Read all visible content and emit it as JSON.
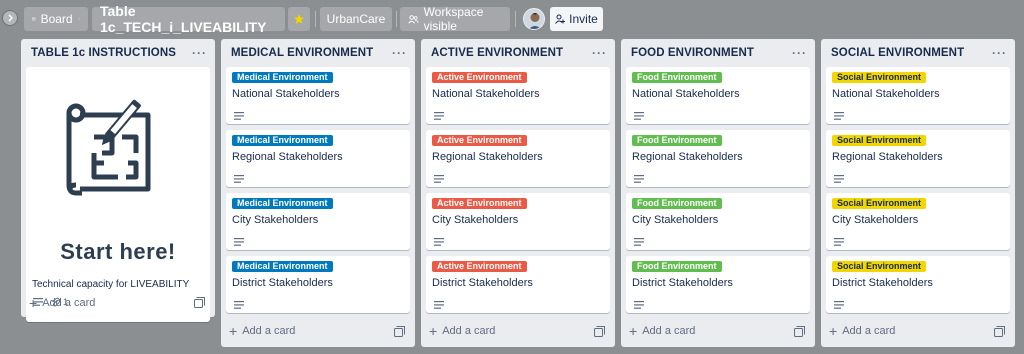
{
  "header": {
    "view_label": "Board",
    "board_title": "Table 1c_TECH_i_LIVEABILITY",
    "workspace_name": "UrbanCare",
    "visibility_label": "Workspace visible",
    "invite_label": "Invite"
  },
  "colors": {
    "medical": "#0079bf",
    "active": "#eb5a46",
    "food": "#61bd4f",
    "social": "#f2d600"
  },
  "instructions_list": {
    "title": "TABLE 1c INSTRUCTIONS",
    "start_text": "Start here!",
    "card_title": "Technical capacity for LIVEABILITY",
    "attachment_count": "1",
    "add_card": "Add a card"
  },
  "lists": [
    {
      "title": "MEDICAL ENVIRONMENT",
      "label": "Medical Environment",
      "cards": [
        "National Stakeholders",
        "Regional Stakeholders",
        "City Stakeholders",
        "District Stakeholders"
      ],
      "add_card": "Add a card"
    },
    {
      "title": "ACTIVE ENVIRONMENT",
      "label": "Active Environment",
      "cards": [
        "National Stakeholders",
        "Regional Stakeholders",
        "City Stakeholders",
        "District Stakeholders"
      ],
      "add_card": "Add a card"
    },
    {
      "title": "FOOD ENVIRONMENT",
      "label": "Food Environment",
      "cards": [
        "National Stakeholders",
        "Regional Stakeholders",
        "City Stakeholders",
        "District Stakeholders"
      ],
      "add_card": "Add a card"
    },
    {
      "title": "SOCIAL ENVIRONMENT",
      "label": "Social Environment",
      "cards": [
        "National Stakeholders",
        "Regional Stakeholders",
        "City Stakeholders",
        "District Stakeholders"
      ],
      "add_card": "Add a card"
    }
  ]
}
